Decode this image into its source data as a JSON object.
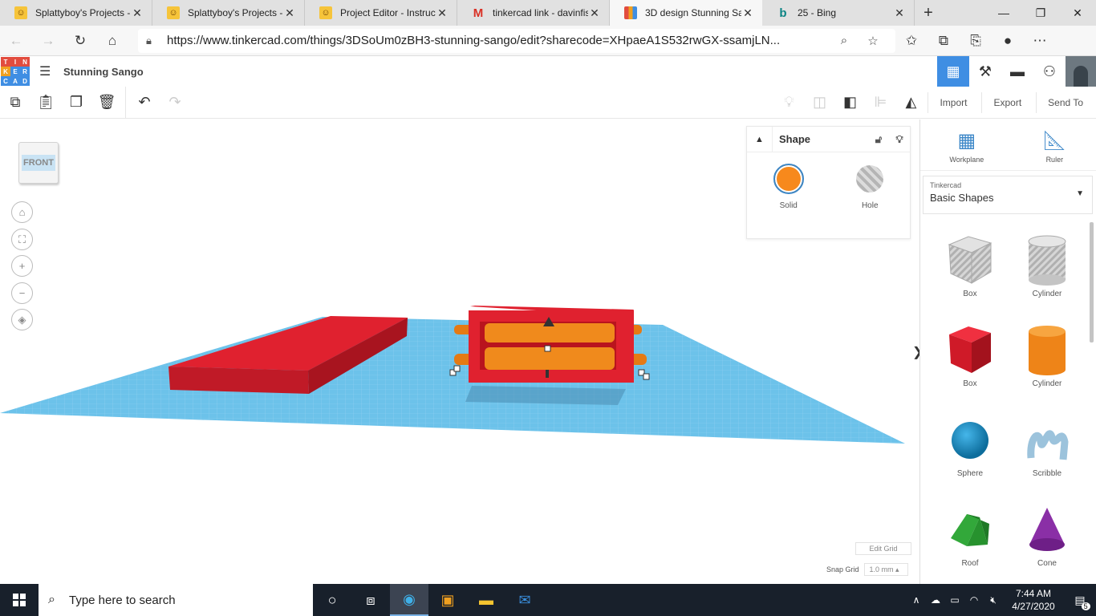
{
  "browser": {
    "tabs": [
      {
        "title": "Splattyboy's Projects - I",
        "icon": "instructables-icon"
      },
      {
        "title": "Splattyboy's Projects - I",
        "icon": "instructables-icon"
      },
      {
        "title": "Project Editor - Instructa",
        "icon": "instructables-icon"
      },
      {
        "title": "tinkercad link - davinfis",
        "icon": "gmail-icon"
      },
      {
        "title": "3D design Stunning Sa",
        "icon": "tinkercad-icon",
        "active": true
      },
      {
        "title": "25 - Bing",
        "icon": "bing-icon"
      }
    ],
    "url": "https://www.tinkercad.com/things/3DSoUm0zBH3-stunning-sango/edit?sharecode=XHpaeA1S532rwGX-ssamjLN..."
  },
  "app": {
    "logo_letters": [
      "T",
      "I",
      "N",
      "K",
      "E",
      "R",
      "C",
      "A",
      "D"
    ],
    "design_name": "Stunning Sango"
  },
  "toolbar": {
    "import_label": "Import",
    "export_label": "Export",
    "send_to_label": "Send To"
  },
  "workspace": {
    "viewcube_label": "FRONT",
    "edit_grid_label": "Edit Grid",
    "snap_grid_label": "Snap Grid",
    "snap_grid_value": "1.0 mm"
  },
  "shape_panel": {
    "title": "Shape",
    "solid_label": "Solid",
    "hole_label": "Hole"
  },
  "sidebar": {
    "workplane_label": "Workplane",
    "ruler_label": "Ruler",
    "library_source": "Tinkercad",
    "library_name": "Basic Shapes",
    "shapes": [
      {
        "label": "Box"
      },
      {
        "label": "Cylinder"
      },
      {
        "label": "Box"
      },
      {
        "label": "Cylinder"
      },
      {
        "label": "Sphere"
      },
      {
        "label": "Scribble"
      },
      {
        "label": "Roof"
      },
      {
        "label": "Cone"
      }
    ]
  },
  "taskbar": {
    "search_placeholder": "Type here to search",
    "time": "7:44 AM",
    "date": "4/27/2020",
    "notification_count": "5"
  },
  "colors": {
    "accent": "#3f8ee3",
    "solid_red": "#e0212f",
    "solid_orange": "#f7891c",
    "grid_blue": "#6cc2ea"
  }
}
